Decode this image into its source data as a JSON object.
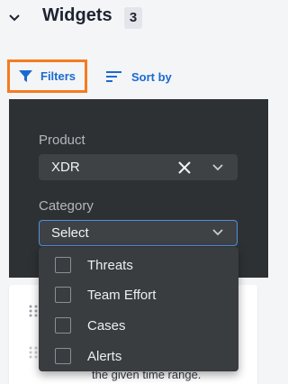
{
  "header": {
    "title": "Widgets",
    "count": "3"
  },
  "toolbar": {
    "filters_label": "Filters",
    "sort_label": "Sort by",
    "filters_highlight": "#f57c1f",
    "link_color": "#1b6ad0"
  },
  "filter_panel": {
    "product": {
      "label": "Product",
      "value": "XDR"
    },
    "category": {
      "label": "Category",
      "placeholder": "Select",
      "options": [
        "Threats",
        "Team Effort",
        "Cases",
        "Alerts"
      ]
    }
  },
  "background_card": {
    "text": "the given time range."
  }
}
